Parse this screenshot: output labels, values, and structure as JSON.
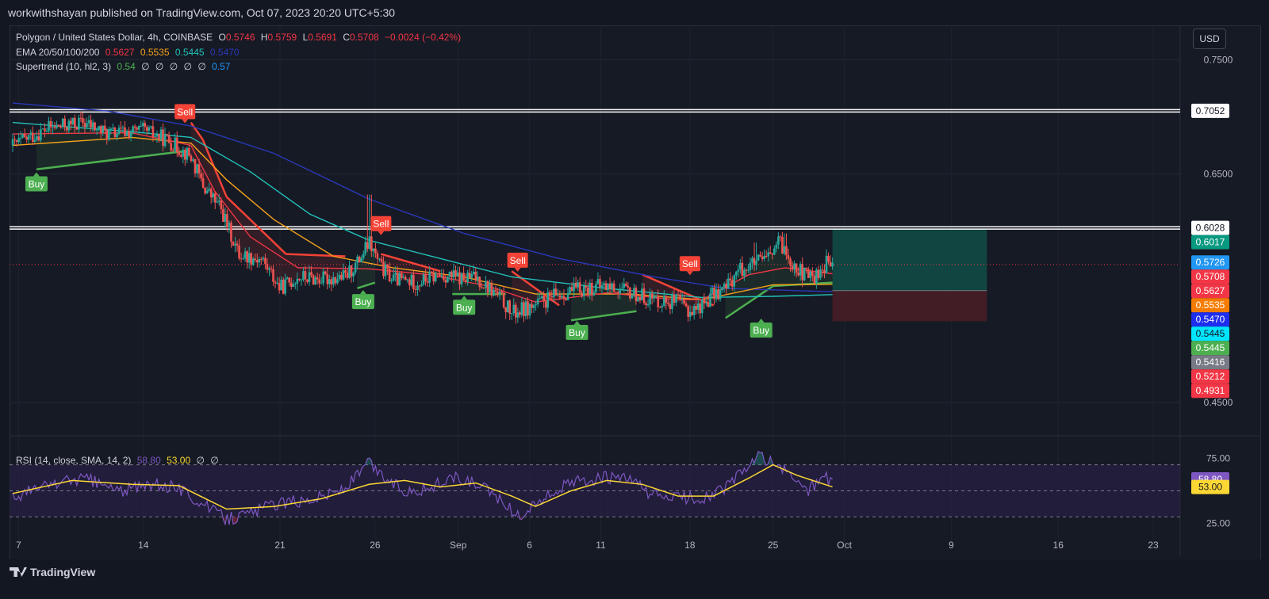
{
  "header": {
    "publish_line": "workwithshayan published on TradingView.com, Oct 07, 2023 20:20 UTC+5:30"
  },
  "legend": {
    "symbol": "Polygon / United States Dollar, 4h, COINBASE",
    "o_label": "O",
    "o_value": "0.5746",
    "h_label": "H",
    "h_value": "0.5759",
    "l_label": "L",
    "l_value": "0.5691",
    "c_label": "C",
    "c_value": "0.5708",
    "change": "−0.0024 (−0.42%)",
    "ema_label": "EMA 20/50/100/200",
    "ema_values": [
      "0.5627",
      "0.5535",
      "0.5445",
      "0.5470"
    ],
    "st_label": "Supertrend (10, hl2, 3)",
    "st_values": [
      "0.54",
      "∅",
      "∅",
      "∅",
      "∅",
      "∅",
      "0.57"
    ],
    "rsi_label": "RSI (14, close, SMA, 14, 2)",
    "rsi_values": [
      "58.80",
      "53.00",
      "∅",
      "∅"
    ]
  },
  "currency_button": "USD",
  "branding": "TradingView",
  "colors": {
    "background": "#161a25",
    "up": "#26a69a",
    "down": "#ef5350",
    "ema20": "#f23645",
    "ema50": "#f7a21b",
    "ema100": "#22c1b8",
    "ema200": "#2a38b8",
    "st_up": "#4caf50",
    "st_down": "#f44336",
    "rsi": "#7e57c2",
    "rsi_ma": "#fdd835",
    "target_zone": "#0f4d48",
    "stop_zone": "#4a1f26"
  },
  "chart_data": {
    "type": "candlestick",
    "x_axis_ticks": [
      "7",
      "14",
      "21",
      "26",
      "Sep",
      "6",
      "11",
      "18",
      "25",
      "Oct",
      "9",
      "16",
      "23"
    ],
    "y_axis_ticks": [
      "0.7500",
      "0.6500",
      "0.4500"
    ],
    "ylim": [
      0.43,
      0.78
    ],
    "horizontal_levels": [
      0.7052,
      0.6028
    ],
    "price_labels": [
      {
        "text": "0.7052",
        "value": 0.7052,
        "bg": "#ffffff",
        "fg": "#131722"
      },
      {
        "text": "0.6028",
        "value": 0.6028,
        "bg": "#ffffff",
        "fg": "#131722"
      },
      {
        "text": "0.6017",
        "value": 0.6017,
        "bg": "#089981",
        "fg": "#ffffff"
      },
      {
        "text": "0.5726",
        "value": 0.5726,
        "bg": "#2196f3",
        "fg": "#ffffff"
      },
      {
        "text": "0.5708",
        "value": 0.5708,
        "bg": "#f23645",
        "fg": "#ffffff"
      },
      {
        "text": "0.5627",
        "value": 0.5627,
        "bg": "#f23645",
        "fg": "#ffffff"
      },
      {
        "text": "0.5535",
        "value": 0.5535,
        "bg": "#f57c00",
        "fg": "#ffffff"
      },
      {
        "text": "0.5470",
        "value": 0.547,
        "bg": "#1e2ef0",
        "fg": "#ffffff"
      },
      {
        "text": "0.5445",
        "value": 0.5445,
        "bg": "#00e5ff",
        "fg": "#131722"
      },
      {
        "text": "0.5445",
        "value": 0.5445,
        "bg": "#4caf50",
        "fg": "#ffffff"
      },
      {
        "text": "0.5416",
        "value": 0.5416,
        "bg": "#787b86",
        "fg": "#ffffff"
      },
      {
        "text": "0.5212",
        "value": 0.5212,
        "bg": "#f23645",
        "fg": "#ffffff"
      },
      {
        "text": "0.4931",
        "value": 0.4931,
        "bg": "#f23645",
        "fg": "#ffffff"
      }
    ],
    "series": [
      {
        "name": "EMA 20"
      },
      {
        "name": "EMA 50"
      },
      {
        "name": "EMA 100"
      },
      {
        "name": "EMA 200"
      },
      {
        "name": "Supertrend"
      }
    ],
    "path_points": [
      {
        "t": 0,
        "p": 0.675
      },
      {
        "t": 3,
        "p": 0.69
      },
      {
        "t": 6,
        "p": 0.695
      },
      {
        "t": 8,
        "p": 0.685
      },
      {
        "t": 11,
        "p": 0.688
      },
      {
        "t": 13,
        "p": 0.68
      },
      {
        "t": 15,
        "p": 0.665
      },
      {
        "t": 16,
        "p": 0.64
      },
      {
        "t": 17.5,
        "p": 0.62
      },
      {
        "t": 19,
        "p": 0.58
      },
      {
        "t": 21,
        "p": 0.575
      },
      {
        "t": 22.5,
        "p": 0.55
      },
      {
        "t": 24,
        "p": 0.56
      },
      {
        "t": 26,
        "p": 0.558
      },
      {
        "t": 28,
        "p": 0.56
      },
      {
        "t": 29,
        "p": 0.572
      },
      {
        "t": 30,
        "p": 0.59
      },
      {
        "t": 31,
        "p": 0.568
      },
      {
        "t": 32,
        "p": 0.558
      },
      {
        "t": 34,
        "p": 0.555
      },
      {
        "t": 36,
        "p": 0.562
      },
      {
        "t": 38,
        "p": 0.558
      },
      {
        "t": 39,
        "p": 0.56
      },
      {
        "t": 41,
        "p": 0.542
      },
      {
        "t": 42,
        "p": 0.528
      },
      {
        "t": 44,
        "p": 0.535
      },
      {
        "t": 46,
        "p": 0.545
      },
      {
        "t": 48,
        "p": 0.55
      },
      {
        "t": 50,
        "p": 0.552
      },
      {
        "t": 52,
        "p": 0.546
      },
      {
        "t": 54,
        "p": 0.54
      },
      {
        "t": 56,
        "p": 0.538
      },
      {
        "t": 57,
        "p": 0.53
      },
      {
        "t": 58,
        "p": 0.535
      },
      {
        "t": 59,
        "p": 0.545
      },
      {
        "t": 60,
        "p": 0.55
      },
      {
        "t": 61,
        "p": 0.565
      },
      {
        "t": 62,
        "p": 0.57
      },
      {
        "t": 63.5,
        "p": 0.575
      },
      {
        "t": 64.5,
        "p": 0.59
      },
      {
        "t": 65.5,
        "p": 0.575
      },
      {
        "t": 66.5,
        "p": 0.562
      },
      {
        "t": 67.5,
        "p": 0.56
      },
      {
        "t": 68.5,
        "p": 0.572
      },
      {
        "t": 69,
        "p": 0.5708
      }
    ],
    "ema20_points": [
      {
        "t": 0,
        "p": 0.685
      },
      {
        "t": 10,
        "p": 0.686
      },
      {
        "t": 15,
        "p": 0.675
      },
      {
        "t": 17,
        "p": 0.635
      },
      {
        "t": 20,
        "p": 0.595
      },
      {
        "t": 24,
        "p": 0.568
      },
      {
        "t": 30,
        "p": 0.567
      },
      {
        "t": 35,
        "p": 0.562
      },
      {
        "t": 40,
        "p": 0.552
      },
      {
        "t": 44,
        "p": 0.538
      },
      {
        "t": 50,
        "p": 0.546
      },
      {
        "t": 56,
        "p": 0.54
      },
      {
        "t": 58,
        "p": 0.54
      },
      {
        "t": 62,
        "p": 0.562
      },
      {
        "t": 65,
        "p": 0.568
      },
      {
        "t": 69,
        "p": 0.5627
      }
    ],
    "ema50_points": [
      {
        "t": 0,
        "p": 0.675
      },
      {
        "t": 10,
        "p": 0.682
      },
      {
        "t": 15,
        "p": 0.677
      },
      {
        "t": 18,
        "p": 0.645
      },
      {
        "t": 22,
        "p": 0.61
      },
      {
        "t": 27,
        "p": 0.578
      },
      {
        "t": 32,
        "p": 0.568
      },
      {
        "t": 38,
        "p": 0.56
      },
      {
        "t": 44,
        "p": 0.545
      },
      {
        "t": 52,
        "p": 0.545
      },
      {
        "t": 58,
        "p": 0.54
      },
      {
        "t": 64,
        "p": 0.553
      },
      {
        "t": 69,
        "p": 0.5535
      }
    ],
    "ema100_points": [
      {
        "t": 0,
        "p": 0.695
      },
      {
        "t": 10,
        "p": 0.687
      },
      {
        "t": 15,
        "p": 0.682
      },
      {
        "t": 20,
        "p": 0.652
      },
      {
        "t": 25,
        "p": 0.615
      },
      {
        "t": 30,
        "p": 0.592
      },
      {
        "t": 36,
        "p": 0.576
      },
      {
        "t": 42,
        "p": 0.56
      },
      {
        "t": 50,
        "p": 0.55
      },
      {
        "t": 58,
        "p": 0.542
      },
      {
        "t": 64,
        "p": 0.543
      },
      {
        "t": 69,
        "p": 0.5445
      }
    ],
    "ema200_points": [
      {
        "t": 0,
        "p": 0.712
      },
      {
        "t": 8,
        "p": 0.705
      },
      {
        "t": 15,
        "p": 0.692
      },
      {
        "t": 22,
        "p": 0.668
      },
      {
        "t": 30,
        "p": 0.628
      },
      {
        "t": 38,
        "p": 0.598
      },
      {
        "t": 46,
        "p": 0.576
      },
      {
        "t": 54,
        "p": 0.56
      },
      {
        "t": 60,
        "p": 0.55
      },
      {
        "t": 69,
        "p": 0.547
      }
    ],
    "supertrend_points": [
      {
        "t": 2,
        "p": 0.654,
        "dir": "up"
      },
      {
        "t": 14.5,
        "p": 0.67,
        "dir": "up"
      },
      {
        "t": 15,
        "p": 0.695,
        "dir": "down"
      },
      {
        "t": 16,
        "p": 0.68,
        "dir": "down"
      },
      {
        "t": 18,
        "p": 0.63,
        "dir": "down"
      },
      {
        "t": 20,
        "p": 0.61,
        "dir": "down"
      },
      {
        "t": 23,
        "p": 0.58,
        "dir": "down"
      },
      {
        "t": 28,
        "p": 0.578,
        "dir": "down"
      },
      {
        "t": 29,
        "p": 0.55,
        "dir": "up"
      },
      {
        "t": 30.5,
        "p": 0.555,
        "dir": "up"
      },
      {
        "t": 31,
        "p": 0.58,
        "dir": "down"
      },
      {
        "t": 36,
        "p": 0.565,
        "dir": "down"
      },
      {
        "t": 37,
        "p": 0.545,
        "dir": "up"
      },
      {
        "t": 41.5,
        "p": 0.545,
        "dir": "up"
      },
      {
        "t": 42,
        "p": 0.565,
        "dir": "down"
      },
      {
        "t": 46,
        "p": 0.535,
        "dir": "down"
      },
      {
        "t": 47,
        "p": 0.522,
        "dir": "up"
      },
      {
        "t": 52.5,
        "p": 0.53,
        "dir": "up"
      },
      {
        "t": 53,
        "p": 0.562,
        "dir": "down"
      },
      {
        "t": 59,
        "p": 0.535,
        "dir": "down"
      },
      {
        "t": 60,
        "p": 0.524,
        "dir": "up"
      },
      {
        "t": 64,
        "p": 0.552,
        "dir": "up"
      },
      {
        "t": 69,
        "p": 0.555,
        "dir": "up"
      }
    ],
    "signals": [
      {
        "label": "Buy",
        "t": 2,
        "p": 0.648,
        "type": "buy"
      },
      {
        "label": "Sell",
        "t": 14.5,
        "p": 0.698,
        "type": "sell"
      },
      {
        "label": "Sell",
        "t": 31,
        "p": 0.6,
        "type": "sell"
      },
      {
        "label": "Buy",
        "t": 29.5,
        "p": 0.545,
        "type": "buy"
      },
      {
        "label": "Buy",
        "t": 38,
        "p": 0.54,
        "type": "buy"
      },
      {
        "label": "Sell",
        "t": 42.5,
        "p": 0.568,
        "type": "sell"
      },
      {
        "label": "Buy",
        "t": 47.5,
        "p": 0.518,
        "type": "buy"
      },
      {
        "label": "Sell",
        "t": 57,
        "p": 0.565,
        "type": "sell"
      },
      {
        "label": "Buy",
        "t": 63,
        "p": 0.52,
        "type": "buy"
      }
    ],
    "position": {
      "t_start": 69,
      "t_end": 82,
      "entry": 0.548,
      "target": 0.6017,
      "stop": 0.5212
    },
    "last_price": 0.5708,
    "last_t": 69,
    "rsi": {
      "ylim": [
        15,
        85
      ],
      "y_ticks": [
        "75.00",
        "25.00"
      ],
      "bands": [
        70,
        50,
        30
      ],
      "last_value": 58.8,
      "last_ma": 53.0,
      "points": [
        {
          "t": 0,
          "v": 45
        },
        {
          "t": 3,
          "v": 55
        },
        {
          "t": 6,
          "v": 60
        },
        {
          "t": 9,
          "v": 50
        },
        {
          "t": 12,
          "v": 55
        },
        {
          "t": 14,
          "v": 52
        },
        {
          "t": 16,
          "v": 40
        },
        {
          "t": 18,
          "v": 28
        },
        {
          "t": 20,
          "v": 33
        },
        {
          "t": 22,
          "v": 40
        },
        {
          "t": 24,
          "v": 42
        },
        {
          "t": 26,
          "v": 46
        },
        {
          "t": 28,
          "v": 52
        },
        {
          "t": 30,
          "v": 72
        },
        {
          "t": 31,
          "v": 62
        },
        {
          "t": 33,
          "v": 50
        },
        {
          "t": 35,
          "v": 52
        },
        {
          "t": 37,
          "v": 60
        },
        {
          "t": 39,
          "v": 55
        },
        {
          "t": 41,
          "v": 44
        },
        {
          "t": 42.5,
          "v": 30
        },
        {
          "t": 44,
          "v": 40
        },
        {
          "t": 46,
          "v": 52
        },
        {
          "t": 48,
          "v": 58
        },
        {
          "t": 50,
          "v": 60
        },
        {
          "t": 52,
          "v": 58
        },
        {
          "t": 54,
          "v": 46
        },
        {
          "t": 56,
          "v": 45
        },
        {
          "t": 58,
          "v": 44
        },
        {
          "t": 60,
          "v": 52
        },
        {
          "t": 62,
          "v": 70
        },
        {
          "t": 63,
          "v": 77
        },
        {
          "t": 64.5,
          "v": 68
        },
        {
          "t": 66,
          "v": 58
        },
        {
          "t": 67,
          "v": 50
        },
        {
          "t": 68,
          "v": 60
        },
        {
          "t": 69,
          "v": 58.8
        }
      ],
      "ma_points": [
        {
          "t": 0,
          "v": 48
        },
        {
          "t": 5,
          "v": 58
        },
        {
          "t": 10,
          "v": 55
        },
        {
          "t": 14,
          "v": 54
        },
        {
          "t": 18,
          "v": 36
        },
        {
          "t": 22,
          "v": 38
        },
        {
          "t": 26,
          "v": 44
        },
        {
          "t": 30,
          "v": 55
        },
        {
          "t": 33,
          "v": 58
        },
        {
          "t": 36,
          "v": 53
        },
        {
          "t": 39,
          "v": 56
        },
        {
          "t": 42,
          "v": 46
        },
        {
          "t": 44,
          "v": 38
        },
        {
          "t": 47,
          "v": 50
        },
        {
          "t": 50,
          "v": 58
        },
        {
          "t": 53,
          "v": 55
        },
        {
          "t": 56,
          "v": 46
        },
        {
          "t": 59,
          "v": 46
        },
        {
          "t": 62,
          "v": 60
        },
        {
          "t": 64,
          "v": 70
        },
        {
          "t": 66,
          "v": 62
        },
        {
          "t": 69,
          "v": 53
        }
      ]
    }
  }
}
